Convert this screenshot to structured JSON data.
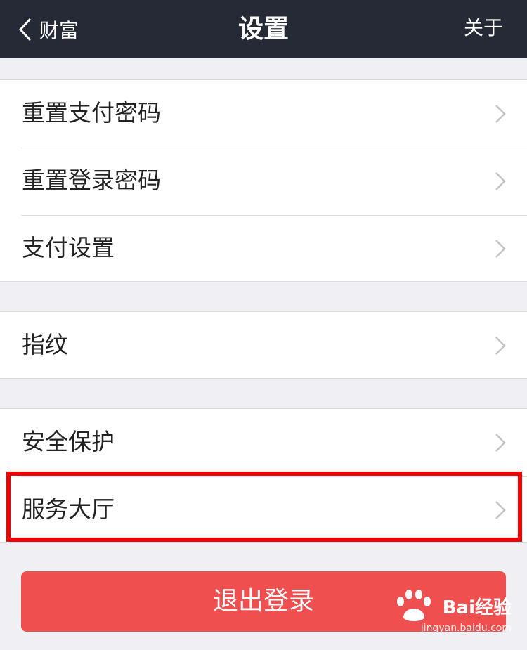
{
  "navbar": {
    "back_label": "财富",
    "title": "设置",
    "right_label": "关于"
  },
  "groups": [
    {
      "items": [
        {
          "label": "重置支付密码"
        },
        {
          "label": "重置登录密码"
        },
        {
          "label": "支付设置"
        }
      ]
    },
    {
      "items": [
        {
          "label": "指纹"
        }
      ]
    },
    {
      "items": [
        {
          "label": "安全保护"
        },
        {
          "label": "服务大厅"
        }
      ]
    }
  ],
  "logout_label": "退出登录",
  "watermark": {
    "brand": "Bai",
    "brand_suffix": "经验",
    "url": "jingyan.baidu.com"
  },
  "colors": {
    "navbar_bg": "#262a36",
    "page_bg": "#efeff4",
    "logout_bg": "#ef4f4f",
    "highlight": "#f40000"
  }
}
